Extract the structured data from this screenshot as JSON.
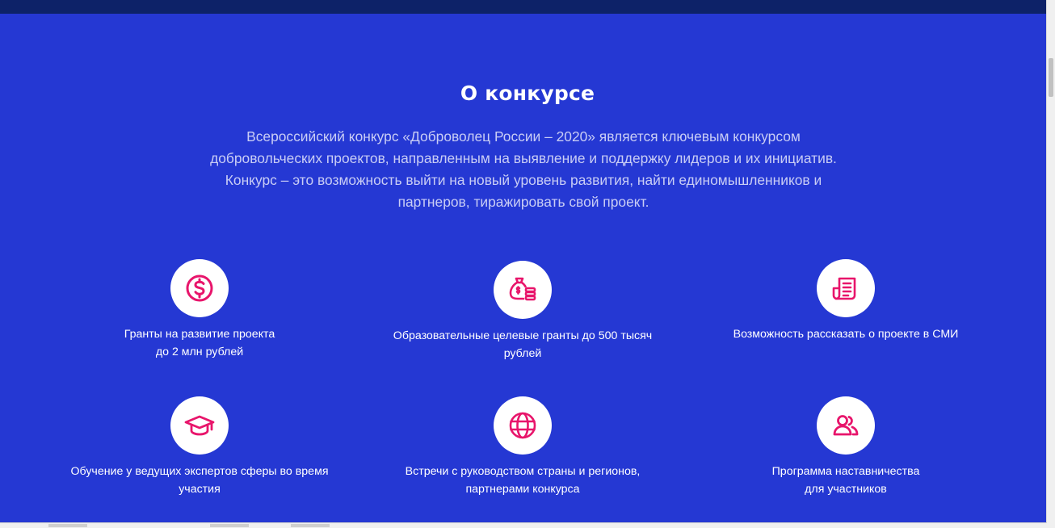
{
  "colors": {
    "background": "#2538d3",
    "topbar": "#0d2268",
    "accent": "#e8156b",
    "icon_bg": "#ffffff"
  },
  "about": {
    "title": "О конкурсе",
    "description": "Всероссийский конкурс «Доброволец России – 2020» является ключевым конкурсом добровольческих проектов, направленным на выявление и поддержку лидеров и их инициатив. Конкурс – это возможность выйти на новый уровень развития, найти единомышленников и партнеров, тиражировать свой проект."
  },
  "features": [
    {
      "icon": "dollar-circle-icon",
      "label": "Гранты на развитие проекта\nдо 2 млн рублей"
    },
    {
      "icon": "money-bag-icon",
      "label": "Образовательные целевые гранты до 500 тысяч\nрублей"
    },
    {
      "icon": "newspaper-icon",
      "label": "Возможность рассказать о проекте в СМИ"
    },
    {
      "icon": "graduation-cap-icon",
      "label": "Обучение у ведущих экспертов сферы во время\nучастия"
    },
    {
      "icon": "globe-icon",
      "label": "Встречи с руководством страны и регионов,\nпартнерами конкурса"
    },
    {
      "icon": "users-icon",
      "label": "Программа наставничества\nдля участников"
    }
  ]
}
